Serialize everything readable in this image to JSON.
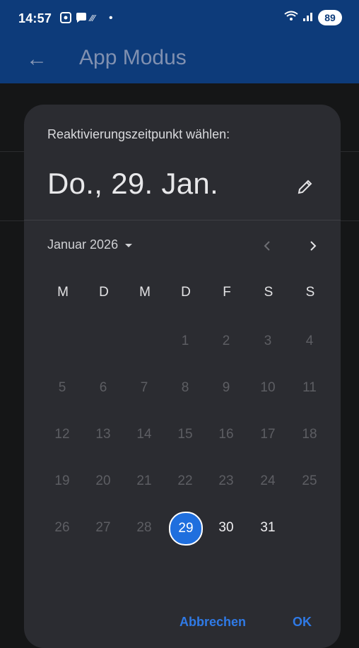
{
  "status_bar": {
    "time": "14:57",
    "battery": "89",
    "icons": [
      "screenshot-icon",
      "chat-icon",
      "signal-bars-icon",
      "dot-icon",
      "wifi-icon",
      "cellular-icon"
    ]
  },
  "app_bar": {
    "title": "App Modus",
    "back_icon": "arrow-left-icon"
  },
  "dialog": {
    "title": "Reaktivierungszeitpunkt wählen:",
    "selected_date": "Do., 29. Jan.",
    "month_label": "Januar 2026",
    "weekdays": [
      "M",
      "D",
      "M",
      "D",
      "F",
      "S",
      "S"
    ],
    "days": [
      {
        "label": "1",
        "state": "disabled"
      },
      {
        "label": "2",
        "state": "disabled"
      },
      {
        "label": "3",
        "state": "disabled"
      },
      {
        "label": "4",
        "state": "disabled"
      },
      {
        "label": "5",
        "state": "disabled"
      },
      {
        "label": "6",
        "state": "disabled"
      },
      {
        "label": "7",
        "state": "disabled"
      },
      {
        "label": "8",
        "state": "disabled"
      },
      {
        "label": "9",
        "state": "disabled"
      },
      {
        "label": "10",
        "state": "disabled"
      },
      {
        "label": "11",
        "state": "disabled"
      },
      {
        "label": "12",
        "state": "disabled"
      },
      {
        "label": "13",
        "state": "disabled"
      },
      {
        "label": "14",
        "state": "disabled"
      },
      {
        "label": "15",
        "state": "disabled"
      },
      {
        "label": "16",
        "state": "disabled"
      },
      {
        "label": "17",
        "state": "disabled"
      },
      {
        "label": "18",
        "state": "disabled"
      },
      {
        "label": "19",
        "state": "disabled"
      },
      {
        "label": "20",
        "state": "disabled"
      },
      {
        "label": "21",
        "state": "disabled"
      },
      {
        "label": "22",
        "state": "disabled"
      },
      {
        "label": "23",
        "state": "disabled"
      },
      {
        "label": "24",
        "state": "disabled"
      },
      {
        "label": "25",
        "state": "disabled"
      },
      {
        "label": "26",
        "state": "disabled"
      },
      {
        "label": "27",
        "state": "disabled"
      },
      {
        "label": "28",
        "state": "disabled"
      },
      {
        "label": "29",
        "state": "selected"
      },
      {
        "label": "30",
        "state": "enabled"
      },
      {
        "label": "31",
        "state": "enabled"
      }
    ],
    "cancel_label": "Abbrechen",
    "ok_label": "OK"
  },
  "colors": {
    "app_bar": "#0d3b7a",
    "dialog_bg": "#2b2c31",
    "accent": "#1f6fde",
    "action_text": "#2f7ae6"
  }
}
